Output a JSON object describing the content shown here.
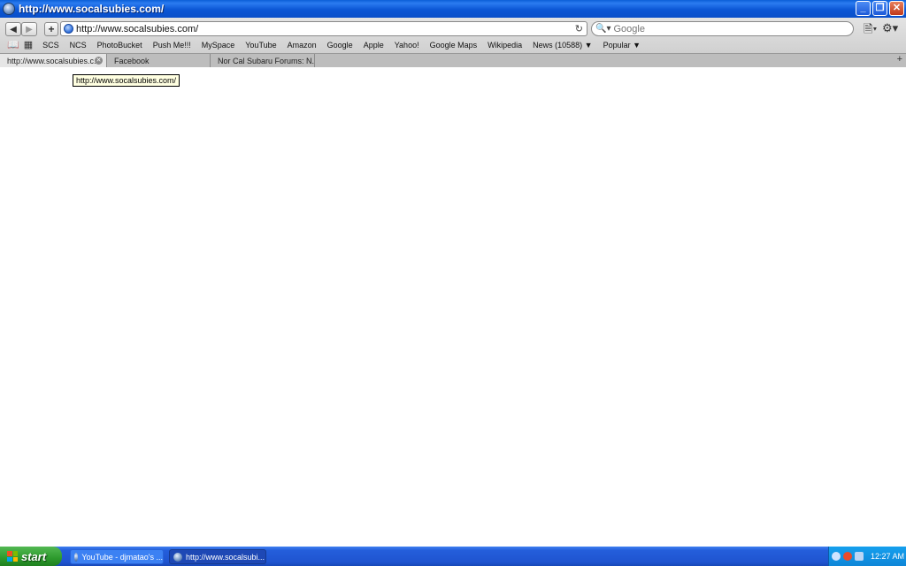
{
  "window": {
    "title": "http://www.socalsubies.com/"
  },
  "nav": {
    "back_icon": "back-arrow-icon",
    "forward_icon": "forward-arrow-icon",
    "add_icon": "plus-icon",
    "address": "http://www.socalsubies.com/",
    "reload_icon": "reload-icon",
    "search_placeholder": "Google"
  },
  "bookmarks": [
    "SCS",
    "NCS",
    "PhotoBucket",
    "Push Me!!!",
    "MySpace",
    "YouTube",
    "Amazon",
    "Google",
    "Apple",
    "Yahoo!",
    "Google Maps",
    "Wikipedia",
    "News (10588)",
    "Popular"
  ],
  "tabs": [
    {
      "label": "http://www.socalsubies.c..."
    },
    {
      "label": "Facebook"
    },
    {
      "label": "Nor Cal Subaru Forums: N..."
    }
  ],
  "tooltip": "http://www.socalsubies.com/",
  "taskbar": {
    "start_label": "start",
    "tasks": [
      "YouTube - djmatao's ...",
      "http://www.socalsubi..."
    ],
    "clock": "12:27 AM"
  }
}
